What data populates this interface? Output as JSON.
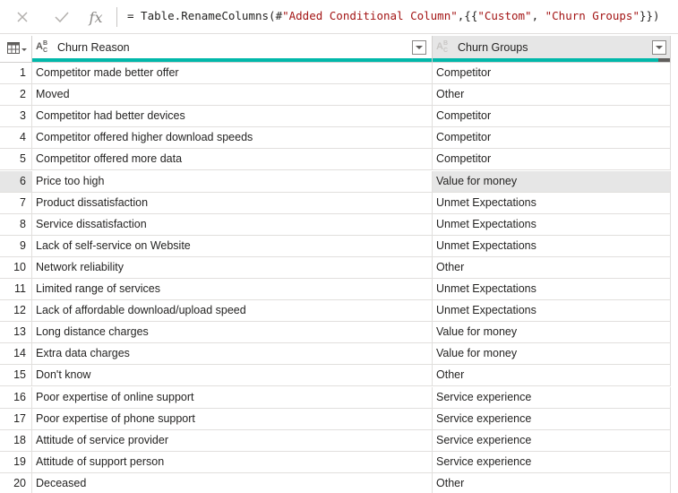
{
  "formula_bar": {
    "fx_label": "fx",
    "formula_prefix": "= Table.RenameColumns(#",
    "formula_step": "\"Added Conditional Column\"",
    "formula_mid1": ",{{",
    "formula_old": "\"Custom\"",
    "formula_mid2": ", ",
    "formula_new": "\"Churn Groups\"",
    "formula_suffix": "}})"
  },
  "columns": {
    "col1": {
      "label": "Churn Reason",
      "type_icon": "text-type-icon",
      "quality_valid": 1.0
    },
    "col2": {
      "label": "Churn Groups",
      "type_icon": "text-type-icon",
      "quality_valid": 0.95
    }
  },
  "selected_row": 6,
  "rows": [
    {
      "n": "1",
      "reason": "Competitor made better offer",
      "group": "Competitor"
    },
    {
      "n": "2",
      "reason": "Moved",
      "group": "Other"
    },
    {
      "n": "3",
      "reason": "Competitor had better devices",
      "group": "Competitor"
    },
    {
      "n": "4",
      "reason": "Competitor offered higher download speeds",
      "group": "Competitor"
    },
    {
      "n": "5",
      "reason": "Competitor offered more data",
      "group": "Competitor"
    },
    {
      "n": "6",
      "reason": "Price too high",
      "group": "Value for money"
    },
    {
      "n": "7",
      "reason": "Product dissatisfaction",
      "group": "Unmet Expectations"
    },
    {
      "n": "8",
      "reason": "Service dissatisfaction",
      "group": "Unmet Expectations"
    },
    {
      "n": "9",
      "reason": "Lack of self-service on Website",
      "group": "Unmet Expectations"
    },
    {
      "n": "10",
      "reason": "Network reliability",
      "group": "Other"
    },
    {
      "n": "11",
      "reason": "Limited range of services",
      "group": "Unmet Expectations"
    },
    {
      "n": "12",
      "reason": "Lack of affordable download/upload speed",
      "group": "Unmet Expectations"
    },
    {
      "n": "13",
      "reason": "Long distance charges",
      "group": "Value for money"
    },
    {
      "n": "14",
      "reason": "Extra data charges",
      "group": "Value for money"
    },
    {
      "n": "15",
      "reason": "Don't know",
      "group": "Other"
    },
    {
      "n": "16",
      "reason": "Poor expertise of online support",
      "group": "Service experience"
    },
    {
      "n": "17",
      "reason": "Poor expertise of phone support",
      "group": "Service experience"
    },
    {
      "n": "18",
      "reason": "Attitude of service provider",
      "group": "Service experience"
    },
    {
      "n": "19",
      "reason": "Attitude of support person",
      "group": "Service experience"
    },
    {
      "n": "20",
      "reason": "Deceased",
      "group": "Other"
    }
  ]
}
